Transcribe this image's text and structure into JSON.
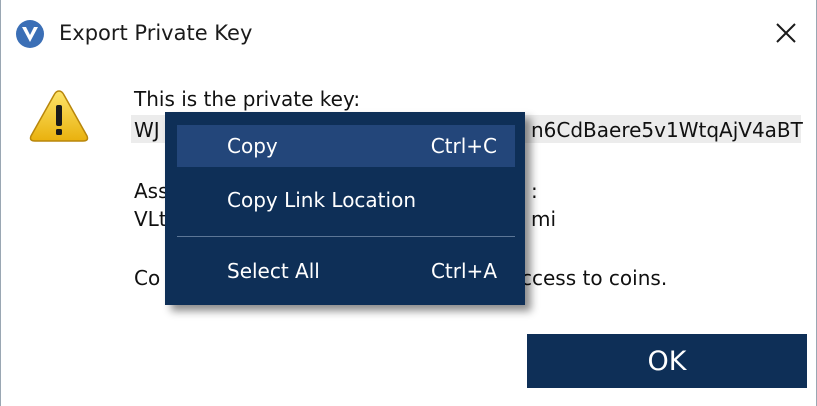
{
  "window": {
    "title": "Export Private Key"
  },
  "dialog": {
    "line_private_key_label": "This is the private key:",
    "private_key_start": "WJ",
    "private_key_end": "n6CdBaere5v1WtqAjV4aBT",
    "line_assoc_start": "Ass",
    "line_assoc_end": ":",
    "address_start": "VLt",
    "address_end": "mi",
    "line_warning_start": "Co",
    "line_warning_end": "ccess to coins.",
    "ok_label": "OK"
  },
  "context_menu": {
    "items": [
      {
        "label": "Copy",
        "shortcut": "Ctrl+C"
      },
      {
        "label": "Copy Link Location",
        "shortcut": ""
      },
      {
        "label": "Select All",
        "shortcut": "Ctrl+A"
      }
    ]
  },
  "colors": {
    "accent": "#0e2f57",
    "menu_hover": "#23467a",
    "app_icon": "#3b6fb6",
    "warning_yellow": "#f2c21b"
  },
  "icons": {
    "app": "v-logo-icon",
    "close": "close-icon",
    "warning": "warning-icon"
  }
}
